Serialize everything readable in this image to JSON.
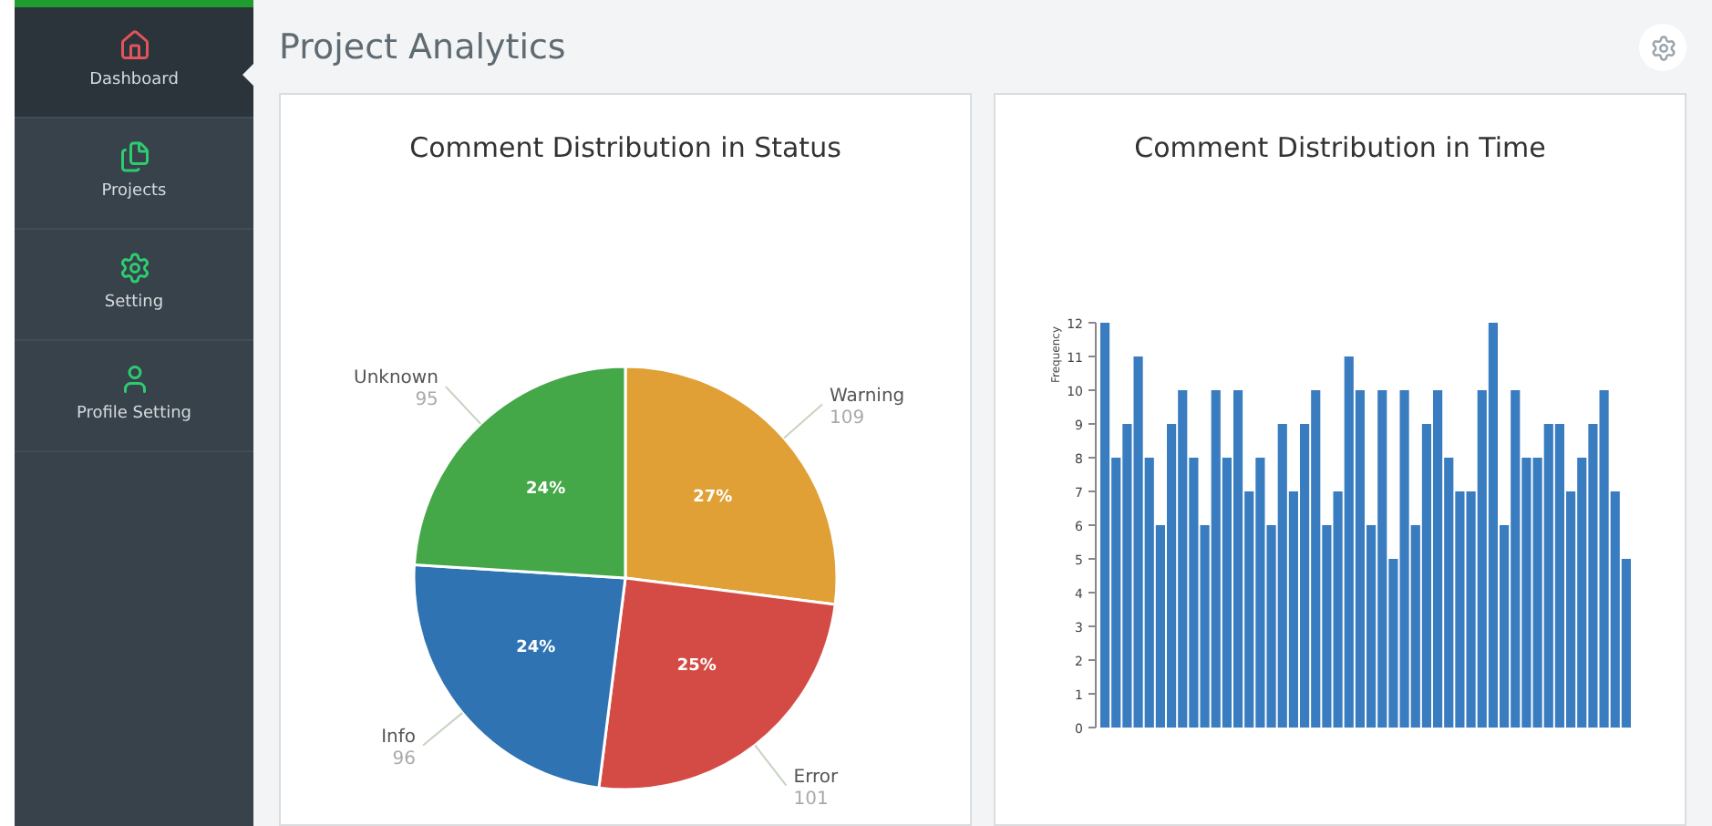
{
  "sidebar": {
    "items": [
      {
        "label": "Dashboard",
        "selected": true
      },
      {
        "label": "Projects",
        "selected": false
      },
      {
        "label": "Setting",
        "selected": false
      },
      {
        "label": "Profile Setting",
        "selected": false
      }
    ]
  },
  "header": {
    "title": "Project Analytics"
  },
  "cards": [
    {
      "title": "Comment Distribution in Status",
      "chart_data": {
        "type": "pie",
        "categories": [
          "Warning",
          "Error",
          "Info",
          "Unknown"
        ],
        "series": [
          {
            "values": [
              27,
              25,
              24,
              24
            ]
          }
        ],
        "colors": [
          "#e0a036",
          "#d44b45",
          "#2f73b3",
          "#45a848"
        ],
        "annotations": [
          "27%",
          "25%",
          "24%",
          "24%"
        ],
        "value_labels": [
          "109",
          "101",
          "96",
          "95"
        ]
      }
    },
    {
      "title": "Comment Distribution in Time",
      "chart_data": {
        "type": "bar",
        "ylabel": "Frequency",
        "yticks": [
          0,
          1,
          2,
          3,
          4,
          5,
          6,
          7,
          8,
          9,
          10,
          11,
          12
        ],
        "ylim": [
          0,
          12
        ],
        "series": [
          {
            "color": "#3a7cc0",
            "values": [
              12,
              8,
              9,
              11,
              8,
              6,
              9,
              10,
              8,
              6,
              10,
              8,
              10,
              7,
              8,
              6,
              9,
              7,
              9,
              10,
              6,
              7,
              11,
              10,
              6,
              10,
              5,
              10,
              6,
              9,
              10,
              8,
              7,
              7,
              10,
              12,
              6,
              10,
              8,
              8,
              9,
              9,
              7,
              8,
              9,
              10,
              7,
              5
            ]
          }
        ]
      }
    }
  ]
}
